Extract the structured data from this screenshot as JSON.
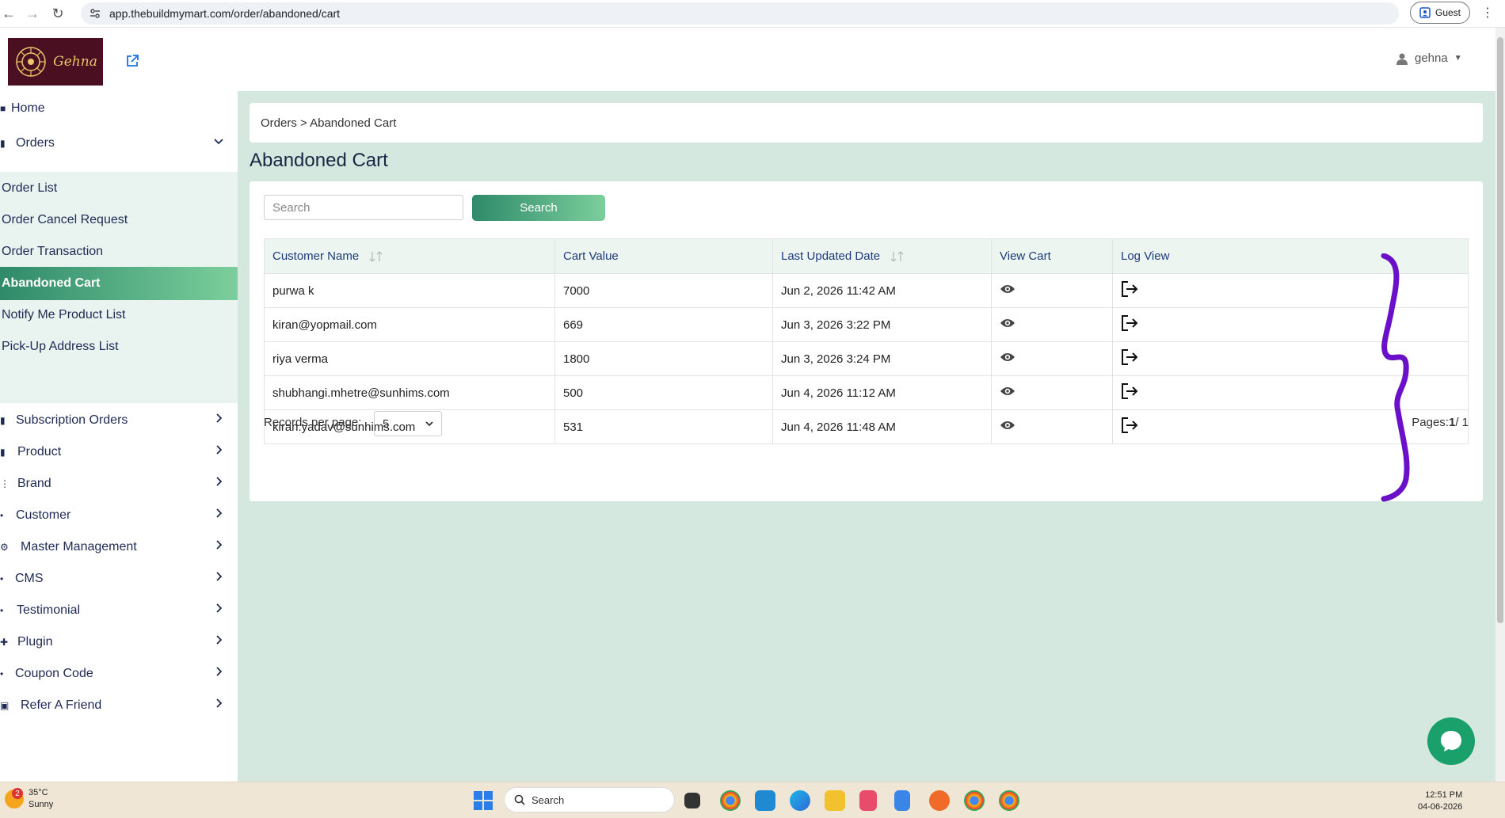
{
  "browser": {
    "url": "app.thebuildmymart.com/order/abandoned/cart",
    "profile_label": "Guest"
  },
  "header": {
    "logo_text": "Gehna",
    "user_name": "gehna"
  },
  "sidebar": {
    "items": [
      {
        "label": "Home"
      },
      {
        "label": "Orders"
      },
      {
        "label": "Subscription Orders"
      },
      {
        "label": "Product"
      },
      {
        "label": "Brand"
      },
      {
        "label": "Customer"
      },
      {
        "label": "Master Management"
      },
      {
        "label": "CMS"
      },
      {
        "label": "Testimonial"
      },
      {
        "label": "Plugin"
      },
      {
        "label": "Coupon Code"
      },
      {
        "label": "Refer A Friend"
      }
    ],
    "orders_submenu": [
      {
        "label": "Order List"
      },
      {
        "label": "Order Cancel Request"
      },
      {
        "label": "Order Transaction"
      },
      {
        "label": "Abandoned Cart",
        "active": true
      },
      {
        "label": "Notify Me Product List"
      },
      {
        "label": "Pick-Up Address List"
      }
    ]
  },
  "breadcrumb": "Orders > Abandoned Cart",
  "page_title": "Abandoned Cart",
  "search": {
    "placeholder": "Search",
    "button_label": "Search"
  },
  "table": {
    "columns": [
      "Customer Name",
      "Cart Value",
      "Last Updated Date",
      "View Cart",
      "Log View"
    ],
    "rows": [
      {
        "customer": "purwa k",
        "value": "7000",
        "date": "Jun 2, 2026 11:42 AM"
      },
      {
        "customer": "kiran@yopmail.com",
        "value": "669",
        "date": "Jun 3, 2026 3:22 PM"
      },
      {
        "customer": "riya verma",
        "value": "1800",
        "date": "Jun 3, 2026 3:24 PM"
      },
      {
        "customer": "shubhangi.mhetre@sunhims.com",
        "value": "500",
        "date": "Jun 4, 2026 11:12 AM"
      },
      {
        "customer": "kiran.yadav@sunhims.com",
        "value": "531",
        "date": "Jun 4, 2026 11:48 AM"
      }
    ]
  },
  "pagination": {
    "records_label": "Records per page:",
    "records_value": "5",
    "pages_prefix": "Pages:",
    "current_page": "1",
    "total_pages": "/ 1"
  },
  "taskbar": {
    "temperature": "35°C",
    "weather": "Sunny",
    "notification_count": "2",
    "search_label": "Search",
    "time": "12:51 PM",
    "date": "04-06-2026"
  },
  "colors": {
    "accent": "#2e8a6a",
    "accent_light": "#7ccf9c",
    "page_bg": "#d4e8df",
    "annotation": "#6a10c9"
  }
}
